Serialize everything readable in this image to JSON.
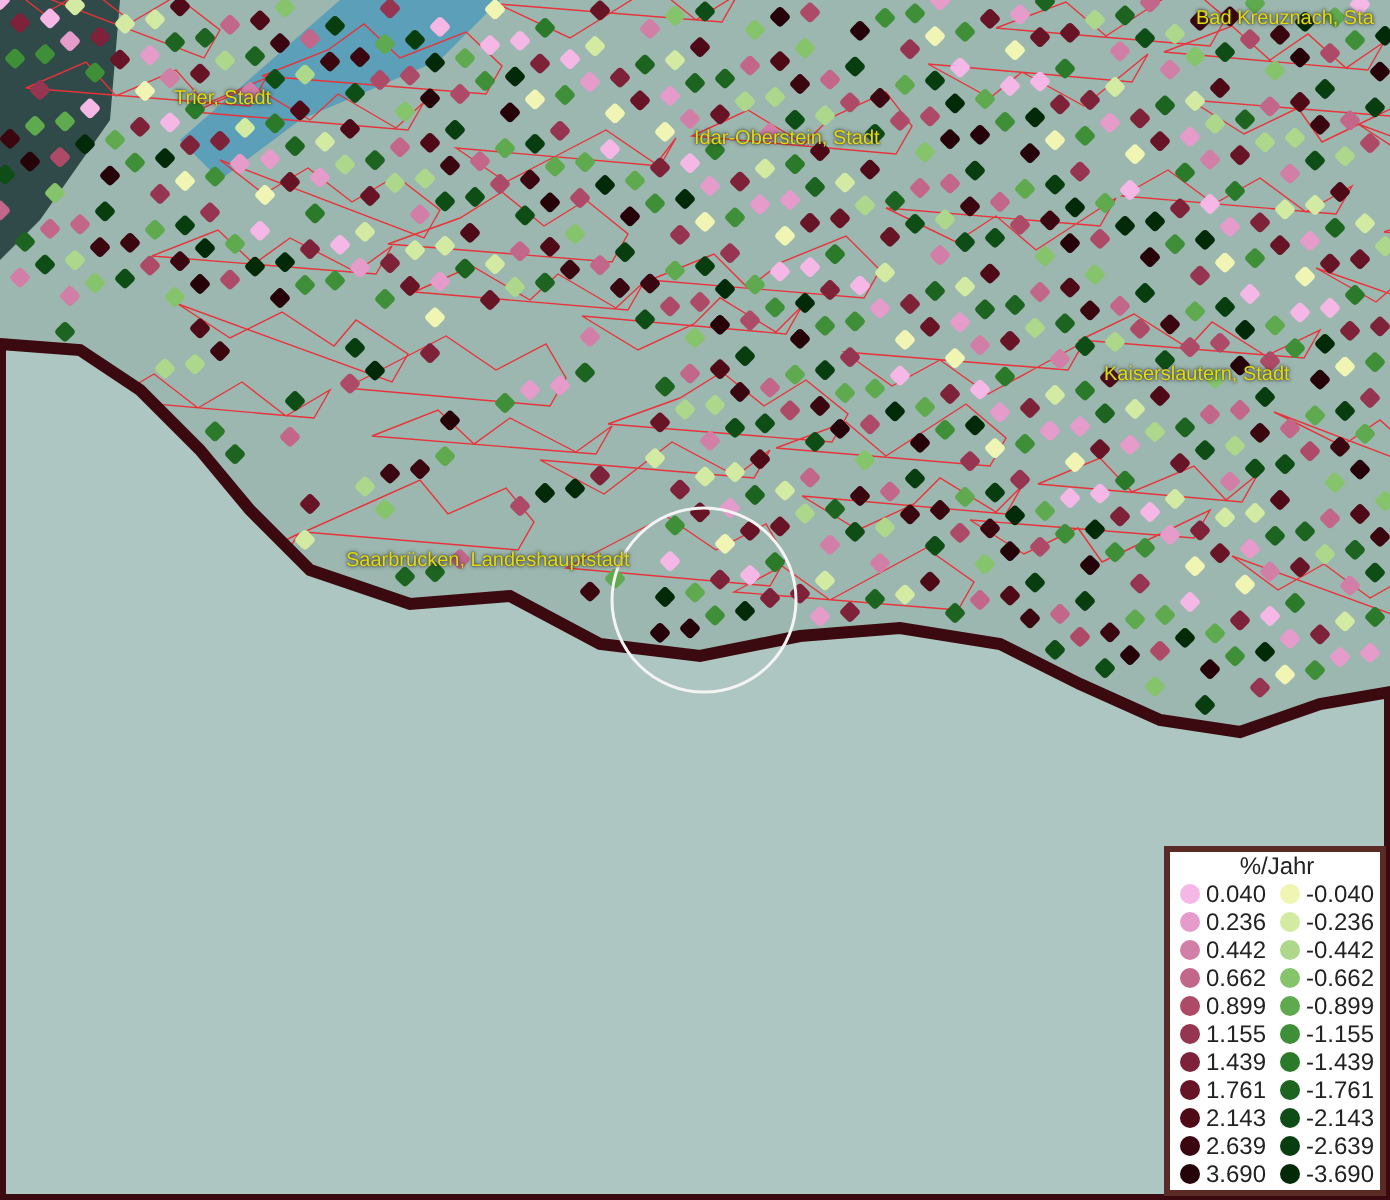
{
  "map": {
    "places": [
      {
        "label": "Trier, Stadt"
      },
      {
        "label": "Idar-Oberstein, Stadt"
      },
      {
        "label": "Bad Kreuznach, Sta"
      },
      {
        "label": "Kaiserslautern, Stadt"
      },
      {
        "label": "Saarbrücken, Landeshauptstadt"
      }
    ]
  },
  "legend": {
    "title": "%/Jahr",
    "rows": [
      {
        "increase": {
          "value": "0.040",
          "color": "#f5b8e6"
        },
        "decrease": {
          "value": "-0.040",
          "color": "#f0f5b4"
        }
      },
      {
        "increase": {
          "value": "0.236",
          "color": "#e59ccb"
        },
        "decrease": {
          "value": "-0.236",
          "color": "#d3eaa2"
        }
      },
      {
        "increase": {
          "value": "0.442",
          "color": "#d27fa7"
        },
        "decrease": {
          "value": "-0.442",
          "color": "#add88c"
        }
      },
      {
        "increase": {
          "value": "0.662",
          "color": "#c2668a"
        },
        "decrease": {
          "value": "-0.662",
          "color": "#86c46c"
        }
      },
      {
        "increase": {
          "value": "0.899",
          "color": "#ad4a68"
        },
        "decrease": {
          "value": "-0.899",
          "color": "#5fa94e"
        }
      },
      {
        "increase": {
          "value": "1.155",
          "color": "#963552"
        },
        "decrease": {
          "value": "-1.155",
          "color": "#3f8f38"
        }
      },
      {
        "increase": {
          "value": "1.439",
          "color": "#7d2239"
        },
        "decrease": {
          "value": "-1.439",
          "color": "#2b7a2a"
        }
      },
      {
        "increase": {
          "value": "1.761",
          "color": "#661426"
        },
        "decrease": {
          "value": "-1.761",
          "color": "#1c6420"
        }
      },
      {
        "increase": {
          "value": "2.143",
          "color": "#4e0a17"
        },
        "decrease": {
          "value": "-2.143",
          "color": "#0f4d16"
        }
      },
      {
        "increase": {
          "value": "2.639",
          "color": "#3a0610"
        },
        "decrease": {
          "value": "-2.639",
          "color": "#083d10"
        }
      },
      {
        "increase": {
          "value": "3.690",
          "color": "#250309"
        },
        "decrease": {
          "value": "-3.690",
          "color": "#032a08"
        }
      }
    ]
  }
}
